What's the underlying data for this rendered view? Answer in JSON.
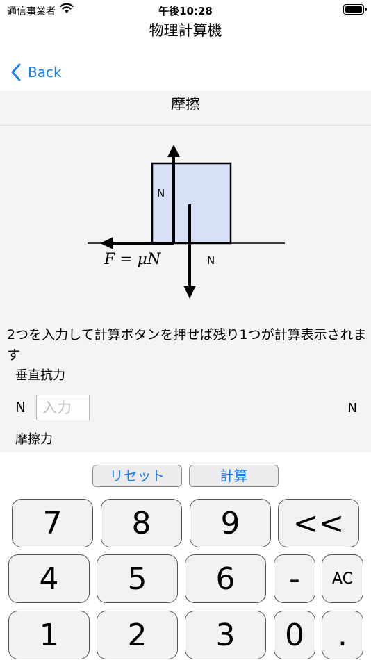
{
  "status_bar": {
    "carrier": "通信事業者",
    "time": "午後10:28",
    "wifi_icon": "wifi-icon",
    "battery_icon": "battery-icon"
  },
  "app": {
    "title": "物理計算機"
  },
  "nav": {
    "back_label": "Back",
    "back_icon": "chevron-left-icon"
  },
  "section": {
    "title": "摩擦"
  },
  "diagram": {
    "normal_label": "N",
    "weight_label": "N",
    "formula": "F = μN"
  },
  "instruction": "2つを入力して計算ボタンを押せば残り1つが計算表示されます",
  "fields": {
    "normal_force_label": "垂直抗力",
    "normal_force_unit": "N",
    "input_placeholder": "入力",
    "input_value": "",
    "friction_unit": "N",
    "friction_label": "摩擦力"
  },
  "actions": {
    "reset_label": "リセット",
    "calc_label": "計算"
  },
  "keypad": {
    "row1": [
      "7",
      "8",
      "9",
      "<<"
    ],
    "row2": [
      "4",
      "5",
      "6",
      "-",
      "AC"
    ],
    "row3": [
      "1",
      "2",
      "3",
      "0",
      "."
    ]
  },
  "colors": {
    "accent": "#1a7cf0",
    "block_fill": "#d7e1f5",
    "panel_bg": "#f4f4f4"
  }
}
